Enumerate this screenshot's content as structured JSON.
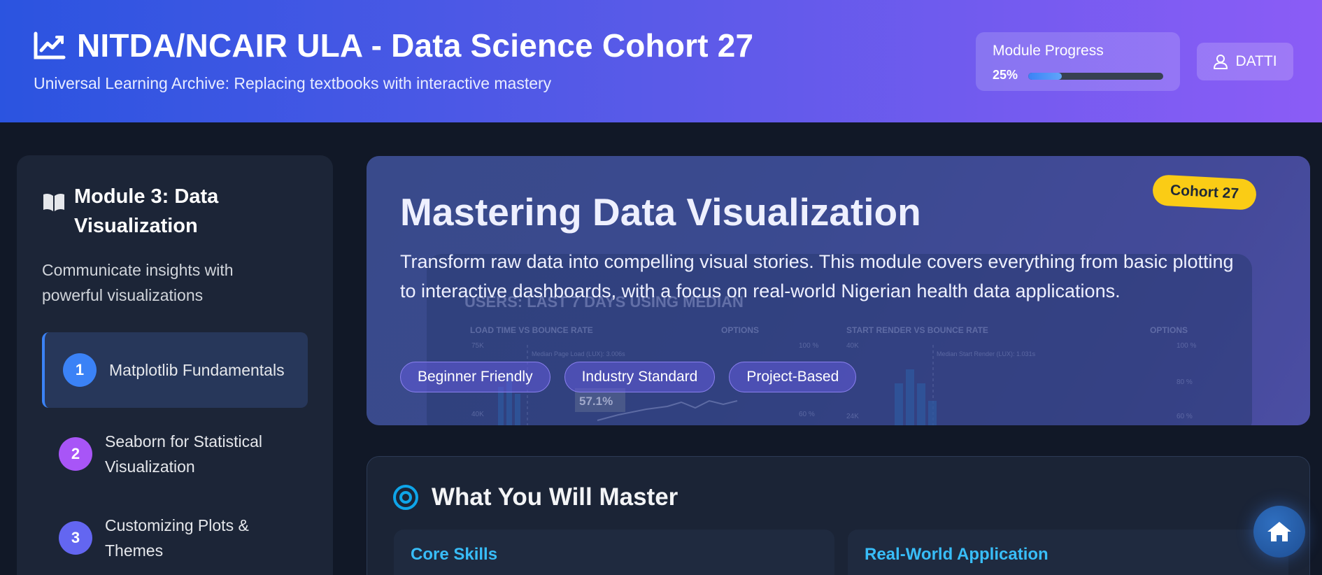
{
  "header": {
    "title": "NITDA/NCAIR ULA - Data Science Cohort 27",
    "subtitle": "Universal Learning Archive: Replacing textbooks with interactive mastery",
    "logo_icon": "chart-line-icon",
    "progress": {
      "label": "Module Progress",
      "value_text": "25%",
      "value": 0.25
    },
    "user": {
      "name": "DATTI",
      "icon": "user-icon"
    }
  },
  "sidebar": {
    "icon": "book-open-icon",
    "title": "Module 3: Data Visualization",
    "description": "Communicate insights with powerful visualizations",
    "lessons": [
      {
        "number": "1",
        "label": "Matplotlib Fundamentals",
        "color": "#3b82f6",
        "active": true
      },
      {
        "number": "2",
        "label": "Seaborn for Statistical Visualization",
        "color": "#a855f7",
        "active": false
      },
      {
        "number": "3",
        "label": "Customizing Plots & Themes",
        "color": "#6366f1",
        "active": false
      }
    ]
  },
  "hero": {
    "title": "Mastering Data Visualization",
    "description": "Transform raw data into compelling visual stories. This module covers everything from basic plotting to interactive dashboards, with a focus on real-world Nigerian health data applications.",
    "badge": "Cohort 27",
    "tags": [
      "Beginner Friendly",
      "Industry Standard",
      "Project-Based"
    ],
    "background_text": {
      "dashboard_title": "USERS: LAST 7 DAYS USING MEDIAN",
      "panel_left_title": "LOAD TIME VS BOUNCE RATE",
      "panel_right_title": "START RENDER VS BOUNCE RATE",
      "options": "OPTIONS",
      "median_left": "Median Page Load (LUX): 3.006s",
      "median_right": "Median Start Render (LUX): 1.031s",
      "tooltip_value": "57.1%",
      "tick_75k": "75K",
      "tick_40k": "40K",
      "tick_100": "100 %",
      "tick_80": "80 %",
      "tick_60": "60 %",
      "tick_24k": "24K",
      "tick_40k_left": "40K"
    }
  },
  "master": {
    "icon": "target-icon",
    "title": "What You Will Master",
    "columns": [
      "Core Skills",
      "Real-World Application"
    ]
  },
  "home_button": {
    "icon": "home-icon"
  },
  "colors": {
    "header_gradient_start": "#2b54e0",
    "header_gradient_end": "#8b5cf6",
    "accent_blue": "#3b82f6",
    "badge_yellow": "#facc15",
    "page_bg": "#111827"
  }
}
